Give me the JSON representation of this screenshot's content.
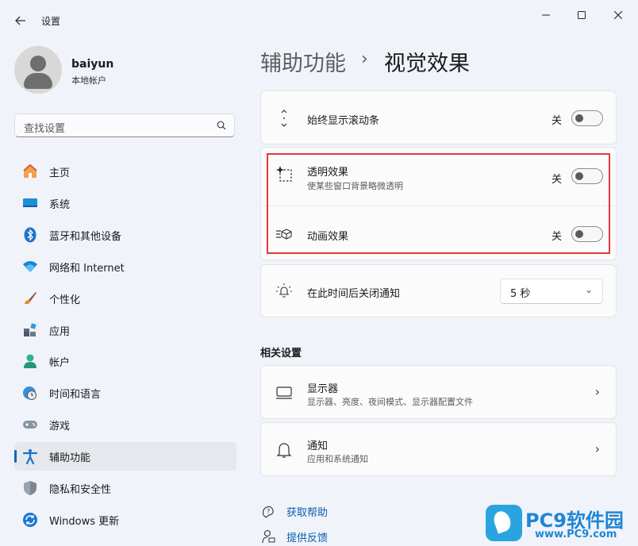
{
  "window": {
    "title": "设置",
    "back_icon": "arrow-left-icon",
    "controls": [
      "minimize-icon",
      "maximize-icon",
      "close-icon"
    ]
  },
  "profile": {
    "name": "baiyun",
    "account_type": "本地帐户"
  },
  "search": {
    "placeholder": "查找设置"
  },
  "nav": {
    "items": [
      {
        "label": "主页",
        "icon": "home-icon"
      },
      {
        "label": "系统",
        "icon": "monitor-icon"
      },
      {
        "label": "蓝牙和其他设备",
        "icon": "bluetooth-icon"
      },
      {
        "label": "网络和 Internet",
        "icon": "wifi-icon"
      },
      {
        "label": "个性化",
        "icon": "brush-icon"
      },
      {
        "label": "应用",
        "icon": "apps-icon"
      },
      {
        "label": "帐户",
        "icon": "person-icon"
      },
      {
        "label": "时间和语言",
        "icon": "clock-globe-icon"
      },
      {
        "label": "游戏",
        "icon": "gamepad-icon"
      },
      {
        "label": "辅助功能",
        "icon": "accessibility-icon",
        "selected": true
      },
      {
        "label": "隐私和安全性",
        "icon": "shield-icon"
      },
      {
        "label": "Windows 更新",
        "icon": "update-icon"
      }
    ]
  },
  "breadcrumb": {
    "parent": "辅助功能",
    "separator": "›",
    "current": "视觉效果"
  },
  "settings": {
    "scrollbars": {
      "title": "始终显示滚动条",
      "state": "关",
      "on": false
    },
    "transparency": {
      "title": "透明效果",
      "subtitle": "使某些窗口背景略微透明",
      "state": "关",
      "on": false
    },
    "animation": {
      "title": "动画效果",
      "state": "关",
      "on": false
    },
    "notification": {
      "title": "在此时间后关闭通知",
      "value": "5 秒"
    }
  },
  "related": {
    "title": "相关设置",
    "display": {
      "title": "显示器",
      "subtitle": "显示器、亮度、夜间模式、显示器配置文件"
    },
    "notifications": {
      "title": "通知",
      "subtitle": "应用和系统通知"
    }
  },
  "links": {
    "help": "获取帮助",
    "feedback": "提供反馈"
  },
  "watermark": {
    "brand": "PC9软件园",
    "url": "www.PC9.com"
  },
  "colors": {
    "accent": "#0067c0",
    "highlight_border": "#e23a3a",
    "link": "#0a5fb0"
  }
}
